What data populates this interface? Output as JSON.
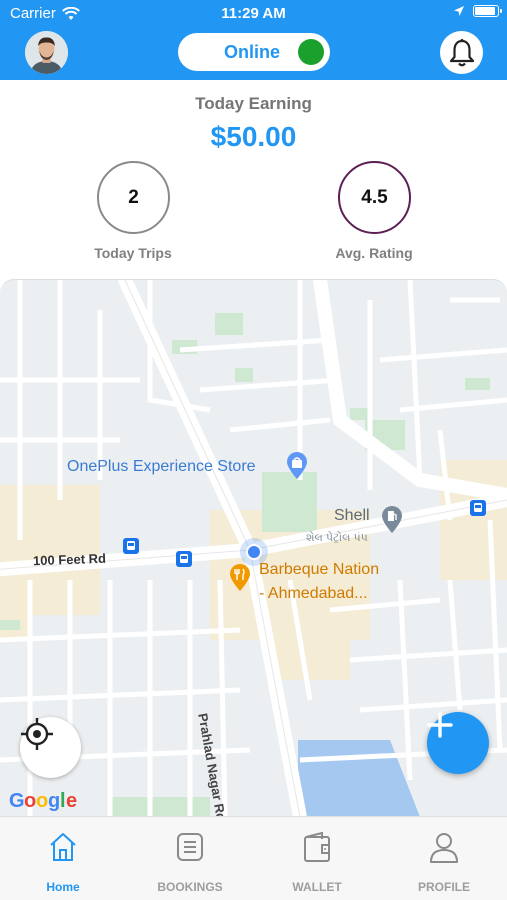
{
  "status_bar": {
    "carrier": "Carrier",
    "time": "11:29 AM"
  },
  "header": {
    "online_label": "Online",
    "online_status_color": "#1aa12d",
    "brand_color": "#2196F3"
  },
  "earnings": {
    "title": "Today Earning",
    "amount": "$50.00",
    "trips_value": "2",
    "trips_label": "Today Trips",
    "rating_value": "4.5",
    "rating_label": "Avg. Rating"
  },
  "map": {
    "place_store": "OnePlus Experience Store",
    "place_shell": "Shell",
    "place_shell_local": "શેલ પેટ્રોલ પંપ",
    "road_100ft": "100 Feet Rd",
    "road_prahlad": "Prahlad Nagar Rd",
    "restaurant_line1": "Barbeque Nation",
    "restaurant_line2": "- Ahmedabad...",
    "attribution": "Google"
  },
  "tabs": [
    {
      "label": "Home",
      "icon": "home-icon",
      "active": true
    },
    {
      "label": "BOOKINGS",
      "icon": "list-icon",
      "active": false
    },
    {
      "label": "WALLET",
      "icon": "wallet-icon",
      "active": false
    },
    {
      "label": "PROFILE",
      "icon": "user-icon",
      "active": false
    }
  ]
}
